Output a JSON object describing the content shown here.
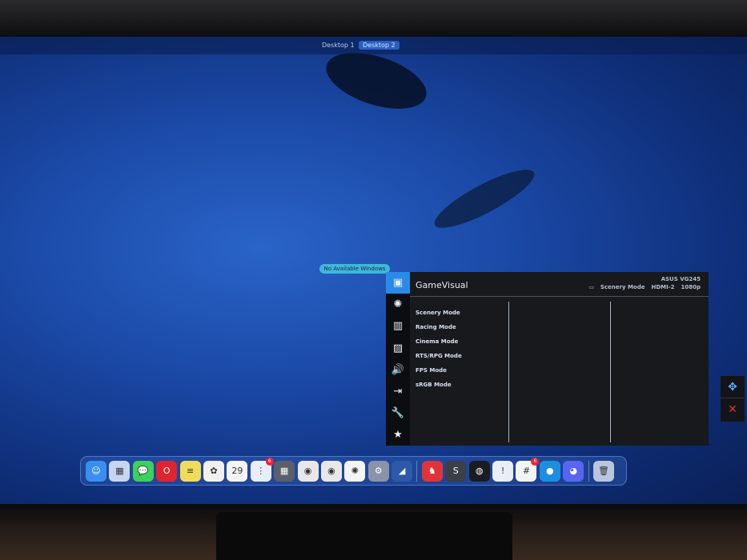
{
  "desktop_bar": {
    "desktops": [
      "Desktop 1",
      "Desktop 2"
    ],
    "active": "Desktop 2"
  },
  "no_windows_label": "No Available Windows",
  "osd": {
    "title": "GameVisual",
    "model": "ASUS VG245",
    "current_mode": "Scenery Mode",
    "input": "HDMI-2",
    "resolution": "1080p",
    "side_icons": [
      "gamevisual-icon",
      "bluelight-icon",
      "color-icon",
      "image-icon",
      "sound-icon",
      "input-select-icon",
      "system-setup-icon",
      "shortcut-icon"
    ],
    "options": [
      "Scenery Mode",
      "Racing Mode",
      "Cinema Mode",
      "RTS/RPG Mode",
      "FPS Mode",
      "sRGB Mode"
    ],
    "accent": "#2a8ae8"
  },
  "dock": {
    "apps": [
      {
        "name": "finder",
        "glyph": "☺",
        "color": "#3a8ef0"
      },
      {
        "name": "launchpad",
        "glyph": "▦",
        "color": "#c9d4f0"
      },
      {
        "name": "messages",
        "glyph": "💬",
        "color": "#3bd15a"
      },
      {
        "name": "opera",
        "glyph": "O",
        "color": "#e0242f"
      },
      {
        "name": "notes",
        "glyph": "≡",
        "color": "#f1dc5a"
      },
      {
        "name": "photos",
        "glyph": "✿",
        "color": "#f0f0f0"
      },
      {
        "name": "calendar",
        "glyph": "29",
        "color": "#f4f4f4"
      },
      {
        "name": "reminders",
        "glyph": "⋮",
        "color": "#e8eef8",
        "badge": "6"
      },
      {
        "name": "calculator",
        "glyph": "▦",
        "color": "#5a5f6a"
      },
      {
        "name": "chrome",
        "glyph": "◉",
        "color": "#e8e8e8"
      },
      {
        "name": "chrome-canary",
        "glyph": "◉",
        "color": "#e8e8e8"
      },
      {
        "name": "chatgpt",
        "glyph": "✺",
        "color": "#f4f4f4"
      },
      {
        "name": "system-settings",
        "glyph": "⚙",
        "color": "#8a93a8"
      },
      {
        "name": "mysql-workbench",
        "glyph": "◢",
        "color": "#2c5aa8"
      },
      {
        "name": "sep"
      },
      {
        "name": "beekeeper",
        "glyph": "♞",
        "color": "#e0343a"
      },
      {
        "name": "sublime",
        "glyph": "S",
        "color": "#3a3f48"
      },
      {
        "name": "linear",
        "glyph": "◍",
        "color": "#1a1c22"
      },
      {
        "name": "1password",
        "glyph": "!",
        "color": "#eaeef6"
      },
      {
        "name": "slack",
        "glyph": "#",
        "color": "#f4f4f4",
        "badge": "6"
      },
      {
        "name": "finch",
        "glyph": "●",
        "color": "#1e8ee0"
      },
      {
        "name": "discord",
        "glyph": "◕",
        "color": "#5865f2"
      },
      {
        "name": "sep"
      },
      {
        "name": "trash",
        "glyph": "🗑",
        "color": "#b9c6de"
      }
    ]
  }
}
